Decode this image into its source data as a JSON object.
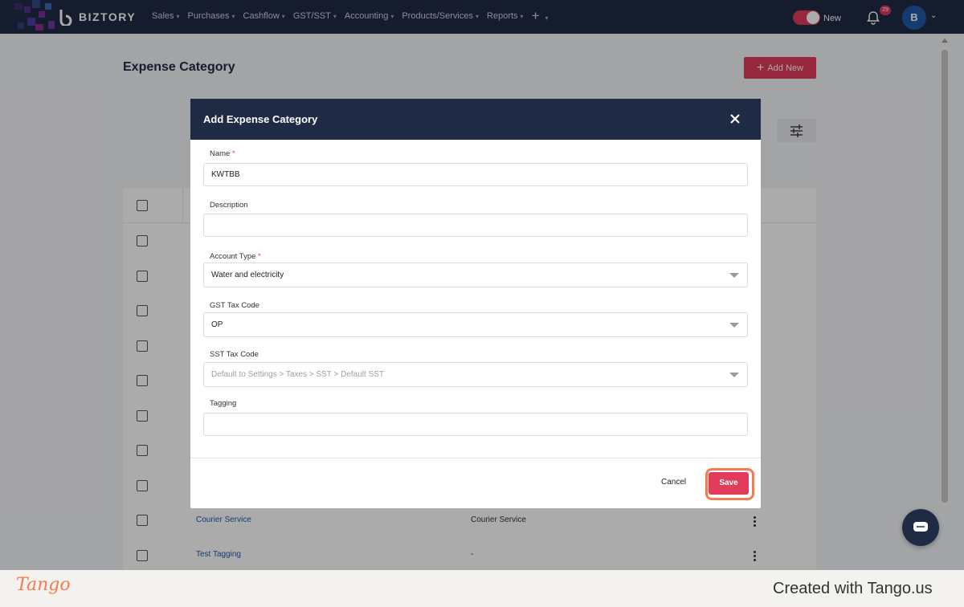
{
  "brand": {
    "name": "BIZTORY"
  },
  "nav": {
    "items": [
      {
        "label": "Sales"
      },
      {
        "label": "Purchases"
      },
      {
        "label": "Cashflow"
      },
      {
        "label": "GST/SST"
      },
      {
        "label": "Accounting"
      },
      {
        "label": "Products/Services"
      },
      {
        "label": "Reports"
      }
    ],
    "plus_icon": "plus-icon",
    "toggle_label": "New",
    "notification_count": "29",
    "avatar_initial": "B"
  },
  "page": {
    "title": "Expense Category",
    "add_new_label": "Add New"
  },
  "table": {
    "rows": [
      {
        "name": "Courier Service",
        "description": "Courier Service"
      },
      {
        "name": "Test Tagging",
        "description": "-"
      }
    ]
  },
  "modal": {
    "title": "Add Expense Category",
    "fields": {
      "name": {
        "label": "Name",
        "value": "KWTBB",
        "required": "*"
      },
      "description": {
        "label": "Description",
        "value": ""
      },
      "account_type": {
        "label": "Account Type",
        "value": "Water and electricity",
        "required": "*"
      },
      "gst_tax_code": {
        "label": "GST Tax Code",
        "value": "OP"
      },
      "sst_tax_code": {
        "label": "SST Tax Code",
        "placeholder": "Default to Settings > Taxes > SST > Default SST"
      },
      "tagging": {
        "label": "Tagging",
        "value": ""
      }
    },
    "cancel_label": "Cancel",
    "save_label": "Save"
  },
  "footer": {
    "logo": "Tango",
    "created_text": "Created with Tango.us"
  },
  "colors": {
    "navy": "#1f2a44",
    "accent": "#e23b5c",
    "highlight": "#f47b4f"
  }
}
